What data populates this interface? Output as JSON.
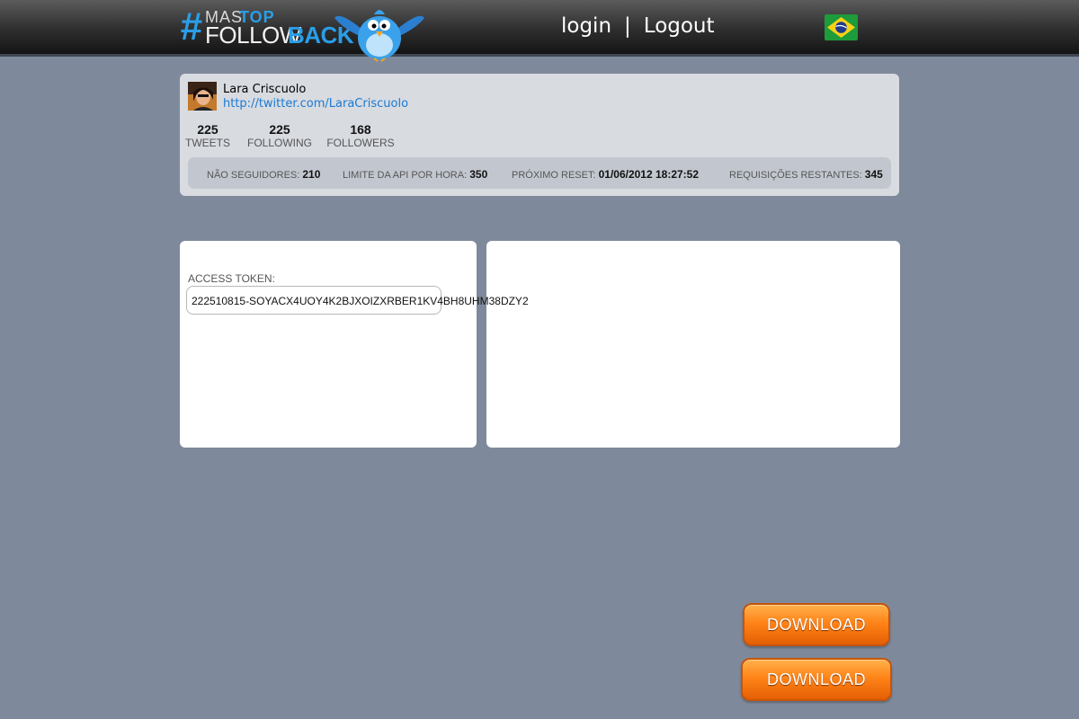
{
  "header": {
    "logo": {
      "hash": "#",
      "mas": "MAS",
      "top": "TOP",
      "follow": "FOLLOW",
      "back": "BACK"
    },
    "nav": {
      "login": "login",
      "separator": "|",
      "logout": "Logout"
    },
    "flag_icon": "brazil-flag-icon"
  },
  "profile": {
    "name": "Lara Criscuolo",
    "url": "http://twitter.com/LaraCriscuolo",
    "stats": [
      {
        "value": "225",
        "label": "TWEETS"
      },
      {
        "value": "225",
        "label": "FOLLOWING"
      },
      {
        "value": "168",
        "label": "FOLLOWERS"
      }
    ],
    "limits": [
      {
        "label": "NÃO SEGUIDORES:",
        "value": "210"
      },
      {
        "label": "LIMITE DA API POR HORA:",
        "value": "350"
      },
      {
        "label": "PRÓXIMO RESET:",
        "value": "01/06/2012 18:27:52"
      },
      {
        "label": "REQUISIÇÕES RESTANTES:",
        "value": "345"
      }
    ]
  },
  "token": {
    "label": "ACCESS TOKEN:",
    "value": "222510815-SOYACX4UOY4K2BJXOIZXRBER1KV4BH8UHM38DZY2"
  },
  "buttons": {
    "download_1": "DOWNLOAD",
    "download_2": "DOWNLOAD"
  },
  "colors": {
    "accent_blue": "#2a9ee8",
    "link_blue": "#1a7ad6",
    "button_orange": "#ff8418",
    "background": "#7e8a9b"
  }
}
